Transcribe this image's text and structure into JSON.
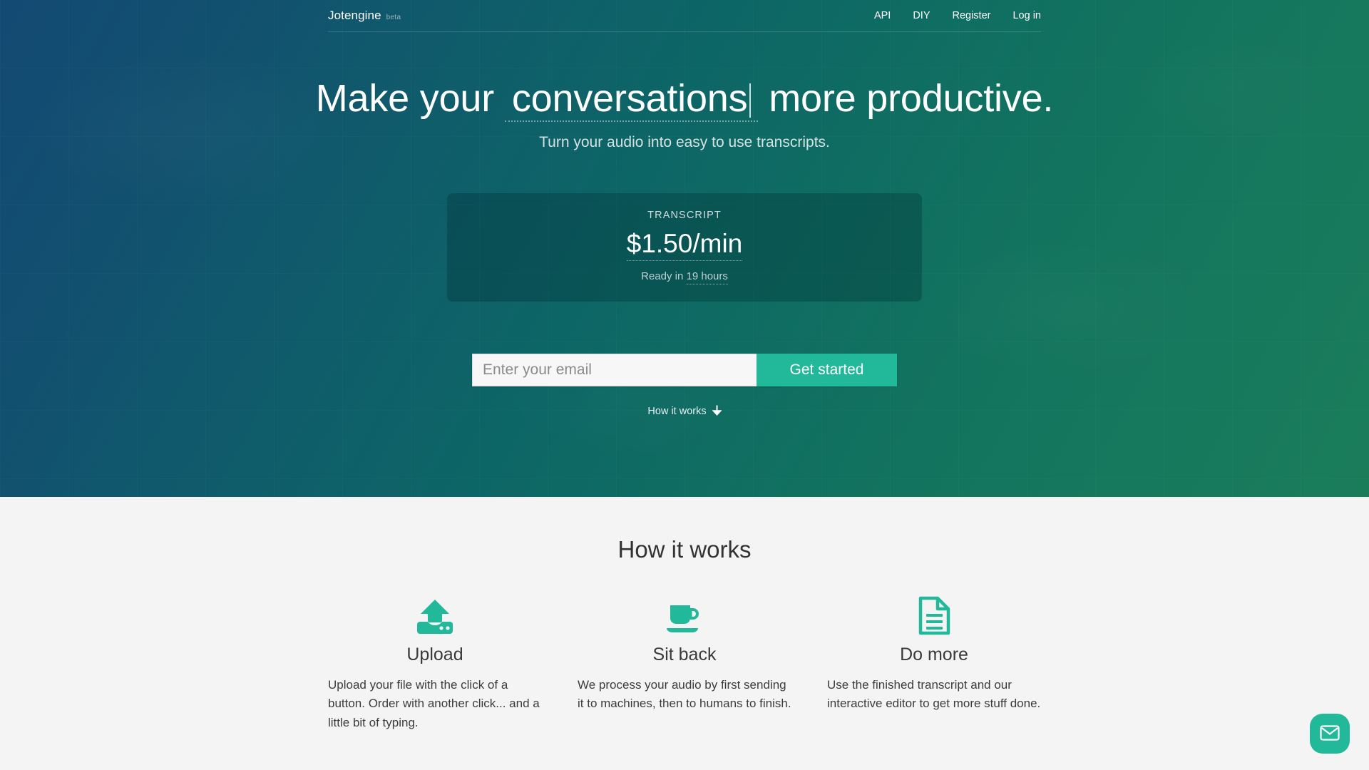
{
  "colors": {
    "accent": "#22b99a",
    "hero_gradient_start": "#134a74",
    "hero_gradient_end": "#1a7d5a",
    "section_bg": "#f4f4f4"
  },
  "nav": {
    "brand_name": "Jotengine",
    "brand_tag": "beta",
    "links": [
      {
        "label": "API"
      },
      {
        "label": "DIY"
      },
      {
        "label": "Register"
      },
      {
        "label": "Log in"
      }
    ]
  },
  "hero": {
    "headline_before": "Make your",
    "headline_editable": "conversations",
    "headline_after": "more productive.",
    "subhead": "Turn your audio into easy to use transcripts.",
    "price_card": {
      "label": "TRANSCRIPT",
      "amount": "$1.50/min",
      "ready_prefix": "Ready in",
      "ready_value": "19 hours"
    },
    "signup": {
      "email_placeholder": "Enter your email",
      "email_value": "",
      "submit_label": "Get started"
    },
    "how_link": {
      "label": "How it works",
      "icon": "arrow-down-icon"
    }
  },
  "works": {
    "title": "How it works",
    "features": [
      {
        "icon": "upload-icon",
        "title": "Upload",
        "desc": "Upload your file with the click of a button. Order with another click... and a little bit of typing."
      },
      {
        "icon": "coffee-cup-icon",
        "title": "Sit back",
        "desc": "We process your audio by first sending it to machines, then to humans to finish."
      },
      {
        "icon": "document-icon",
        "title": "Do more",
        "desc": "Use the finished transcript and our interactive editor to get more stuff done."
      }
    ]
  },
  "chat": {
    "icon": "envelope-icon"
  }
}
